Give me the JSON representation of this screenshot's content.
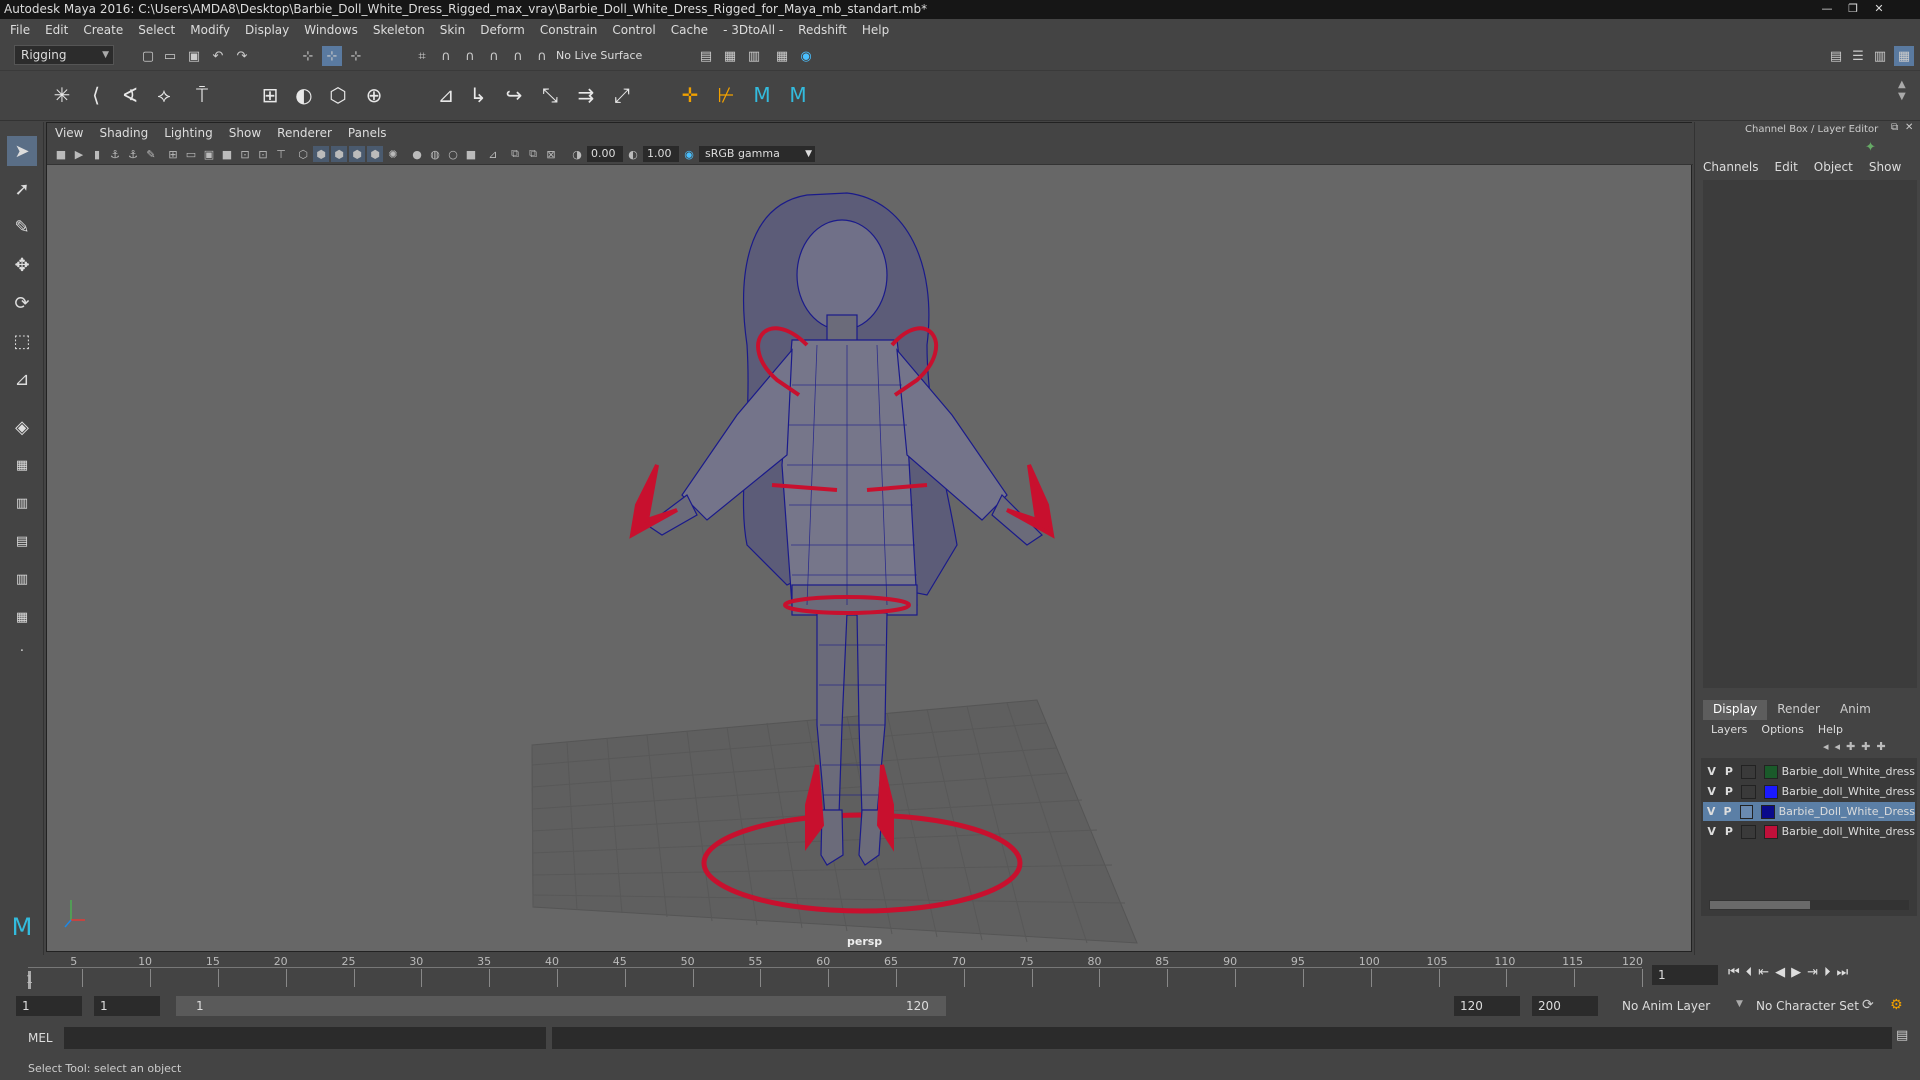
{
  "window": {
    "title": "Autodesk Maya 2016: C:\\Users\\AMDA8\\Desktop\\Barbie_Doll_White_Dress_Rigged_max_vray\\Barbie_Doll_White_Dress_Rigged_for_Maya_mb_standart.mb*",
    "minimize": "—",
    "maximize": "❐",
    "close": "✕"
  },
  "menubar": [
    "File",
    "Edit",
    "Create",
    "Select",
    "Modify",
    "Display",
    "Windows",
    "Skeleton",
    "Skin",
    "Deform",
    "Constrain",
    "Control",
    "Cache",
    "- 3DtoAll -",
    "Redshift",
    "Help"
  ],
  "statusline": {
    "mode": "Rigging",
    "live_surface": "No Live Surface"
  },
  "viewport": {
    "menu": [
      "View",
      "Shading",
      "Lighting",
      "Show",
      "Renderer",
      "Panels"
    ],
    "exposure": "0.00",
    "gamma": "1.00",
    "color_space": "sRGB gamma",
    "camera": "persp"
  },
  "channelbox": {
    "title": "Channel Box / Layer Editor",
    "menu": [
      "Channels",
      "Edit",
      "Object",
      "Show"
    ]
  },
  "layer_editor": {
    "tabs": [
      "Display",
      "Render",
      "Anim"
    ],
    "menu": [
      "Layers",
      "Options",
      "Help"
    ],
    "layers": [
      {
        "v": "V",
        "p": "P",
        "color": "#1a5a2a",
        "name": "Barbie_doll_White_dress",
        "selected": false
      },
      {
        "v": "V",
        "p": "P",
        "color": "#1a1aff",
        "name": "Barbie_doll_White_dress",
        "selected": false
      },
      {
        "v": "V",
        "p": "P",
        "color": "#0a0a8a",
        "name": "Barbie_Doll_White_Dress",
        "selected": true
      },
      {
        "v": "V",
        "p": "P",
        "color": "#c0103a",
        "name": "Barbie_doll_White_dress",
        "selected": false
      }
    ]
  },
  "timeline": {
    "ticks": [
      "5",
      "10",
      "15",
      "20",
      "25",
      "30",
      "35",
      "40",
      "45",
      "50",
      "55",
      "60",
      "65",
      "70",
      "75",
      "80",
      "85",
      "90",
      "95",
      "100",
      "105",
      "110",
      "115",
      "120"
    ],
    "start_label": "1",
    "current_frame": "1"
  },
  "range": {
    "start": "1",
    "playback_start": "1",
    "slider_start": "1",
    "slider_end": "120",
    "playback_end": "120",
    "end": "200",
    "anim_layer": "No Anim Layer",
    "character_set": "No Character Set"
  },
  "cmdline": {
    "language": "MEL"
  },
  "helpline": "Select Tool: select an object",
  "colors": {
    "rig_red": "#c8102e",
    "wire_blue": "#1a1a8a",
    "bg": "#676767"
  }
}
